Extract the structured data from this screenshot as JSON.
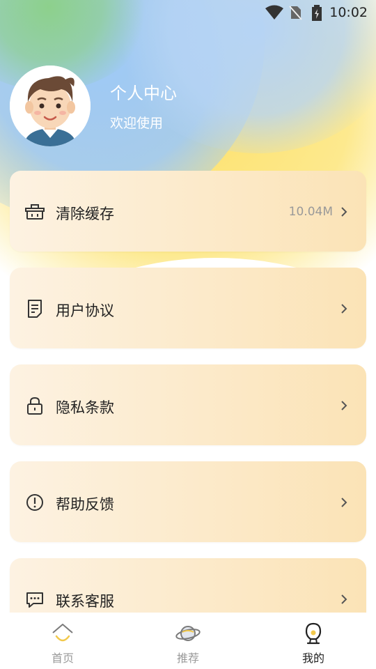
{
  "status_bar": {
    "time": "10:02"
  },
  "profile": {
    "title": "个人中心",
    "subtitle": "欢迎使用"
  },
  "menu": [
    {
      "label": "清除缓存",
      "value": "10.04M",
      "icon": "basket-icon"
    },
    {
      "label": "用户协议",
      "value": "",
      "icon": "document-icon"
    },
    {
      "label": "隐私条款",
      "value": "",
      "icon": "lock-icon"
    },
    {
      "label": "帮助反馈",
      "value": "",
      "icon": "alert-circle-icon"
    },
    {
      "label": "联系客服",
      "value": "",
      "icon": "chat-icon"
    }
  ],
  "tabs": [
    {
      "label": "首页",
      "icon": "home-icon",
      "active": false
    },
    {
      "label": "推荐",
      "icon": "planet-icon",
      "active": false
    },
    {
      "label": "我的",
      "icon": "profile-icon",
      "active": true
    }
  ]
}
